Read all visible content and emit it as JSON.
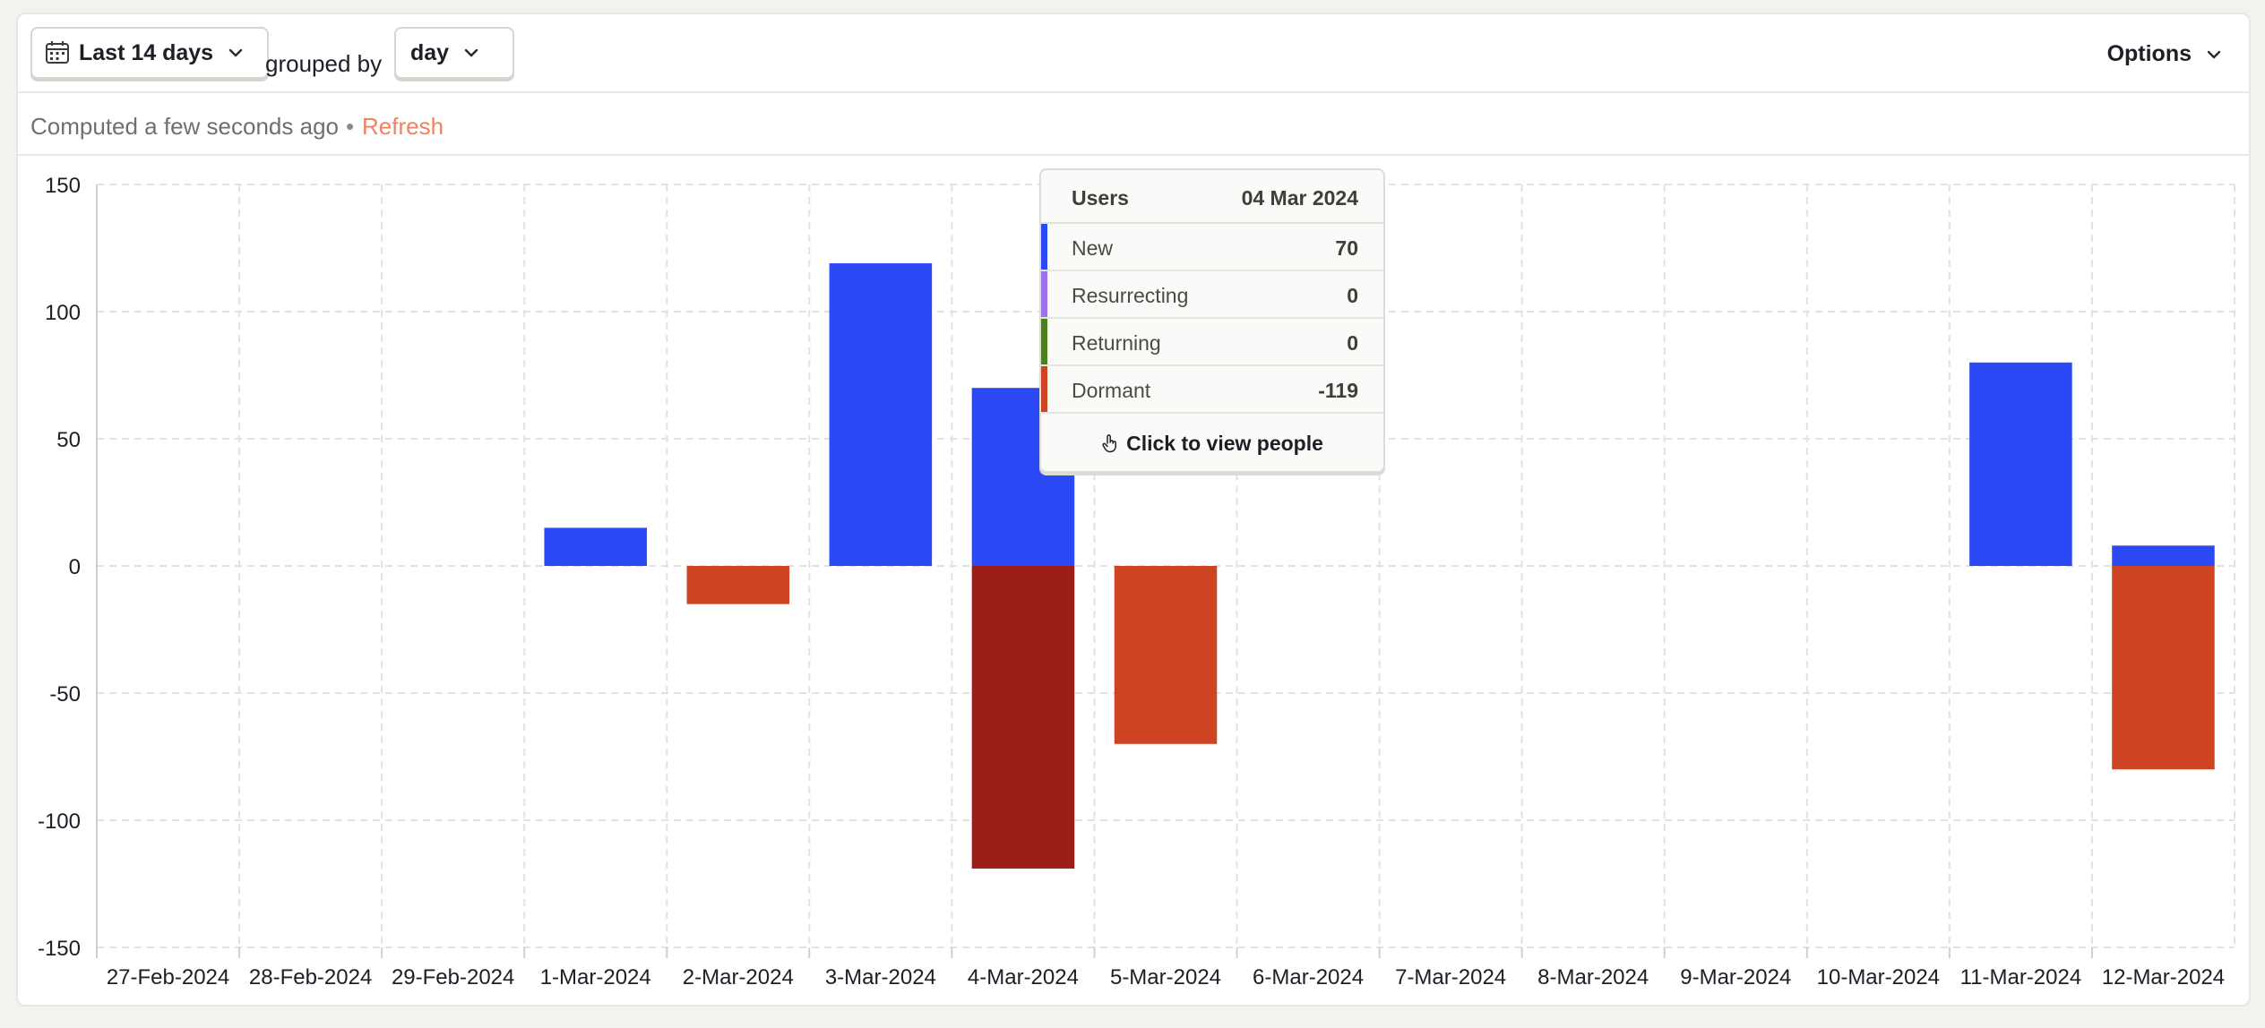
{
  "toolbar": {
    "date_range_label": "Last 14 days",
    "grouped_by_text": "grouped by",
    "interval_label": "day",
    "options_label": "Options"
  },
  "status": {
    "computed_text": "Computed a few seconds ago",
    "separator": "•",
    "refresh_label": "Refresh"
  },
  "colors": {
    "new": "#2b49f5",
    "resurrecting": "#a070e8",
    "returning": "#4b7e1f",
    "dormant": "#cc4422",
    "dormant_highlight": "#9b1f16"
  },
  "icons": {
    "date": "calendar-icon",
    "dropdown": "chevron-down-icon",
    "people": "pointer-hand-icon"
  },
  "tooltip": {
    "title": "Users",
    "date": "04 Mar 2024",
    "rows": [
      {
        "name": "New",
        "value": "70",
        "color": "#2b49f5"
      },
      {
        "name": "Resurrecting",
        "value": "0",
        "color": "#a070e8"
      },
      {
        "name": "Returning",
        "value": "0",
        "color": "#4b7e1f"
      },
      {
        "name": "Dormant",
        "value": "-119",
        "color": "#cc4422"
      }
    ],
    "action_label": "Click to view people"
  },
  "chart_data": {
    "type": "bar",
    "stacked": true,
    "categories": [
      "27-Feb-2024",
      "28-Feb-2024",
      "29-Feb-2024",
      "1-Mar-2024",
      "2-Mar-2024",
      "3-Mar-2024",
      "4-Mar-2024",
      "5-Mar-2024",
      "6-Mar-2024",
      "7-Mar-2024",
      "8-Mar-2024",
      "9-Mar-2024",
      "10-Mar-2024",
      "11-Mar-2024",
      "12-Mar-2024"
    ],
    "series": [
      {
        "name": "New",
        "values": [
          0,
          0,
          0,
          15,
          0,
          119,
          70,
          0,
          0,
          0,
          0,
          0,
          0,
          80,
          8
        ]
      },
      {
        "name": "Resurrecting",
        "values": [
          0,
          0,
          0,
          0,
          0,
          0,
          0,
          0,
          0,
          0,
          0,
          0,
          0,
          0,
          0
        ]
      },
      {
        "name": "Returning",
        "values": [
          0,
          0,
          0,
          0,
          0,
          0,
          0,
          0,
          0,
          0,
          0,
          0,
          0,
          0,
          0
        ]
      },
      {
        "name": "Dormant",
        "values": [
          0,
          0,
          0,
          0,
          -15,
          0,
          -119,
          -70,
          0,
          0,
          0,
          0,
          0,
          0,
          -80
        ]
      }
    ],
    "highlighted_category": "4-Mar-2024",
    "yticks": [
      150,
      100,
      50,
      0,
      -50,
      -100,
      -150
    ],
    "ylim": [
      -150,
      150
    ],
    "grid": true
  }
}
